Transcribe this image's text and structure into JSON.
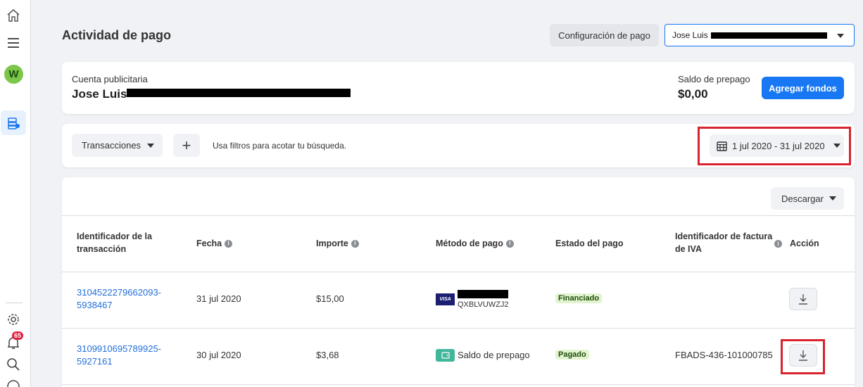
{
  "header": {
    "title": "Actividad de pago",
    "config_button": "Configuración de pago",
    "account_select_value": "Jose Luis"
  },
  "account_card": {
    "label": "Cuenta publicitaria",
    "name": "Jose Luis",
    "balance_label": "Saldo de prepago",
    "balance_value": "$0,00",
    "add_funds_button": "Agregar fondos"
  },
  "filters": {
    "transactions_button": "Transacciones",
    "add_filter_symbol": "+",
    "hint": "Usa filtros para acotar tu búsqueda.",
    "date_range": "1 jul 2020 - 31 jul 2020"
  },
  "table": {
    "download_button": "Descargar",
    "columns": [
      {
        "line1": "Identificador de la",
        "line2": "transacción",
        "info": false
      },
      {
        "line1": "Fecha",
        "line2": "",
        "info": true
      },
      {
        "line1": "Importe",
        "line2": "",
        "info": true
      },
      {
        "line1": "Método de pago",
        "line2": "",
        "info": true
      },
      {
        "line1": "Estado del pago",
        "line2": "",
        "info": false
      },
      {
        "line1": "Identificador de factura",
        "line2": "de IVA",
        "info": true
      },
      {
        "line1": "Acción",
        "line2": "",
        "info": false
      }
    ],
    "rows": [
      {
        "id_line1": "3104522279662093-",
        "id_line2": "5938467",
        "date": "31 jul 2020",
        "amount": "$15,00",
        "payment_card_brand": "VISA",
        "payment_code": "QXBLVUWZJ2",
        "status": "Financiado",
        "invoice": ""
      },
      {
        "id_line1": "3109910695789925-",
        "id_line2": "5927161",
        "date": "30 jul 2020",
        "amount": "$3,68",
        "payment_method": "Saldo de prepago",
        "status": "Pagado",
        "invoice": "FBADS-436-101000785"
      }
    ]
  },
  "sidebar": {
    "avatar_letter": "W",
    "notification_count": "65",
    "icons": [
      "home-icon",
      "menu-icon",
      "billing-icon",
      "settings-icon",
      "bell-icon",
      "search-icon",
      "help-icon"
    ]
  },
  "colors": {
    "primary": "#1877f2",
    "highlight": "#d9232e",
    "status_green_bg": "#e1f4cf",
    "link": "#216fdb"
  }
}
